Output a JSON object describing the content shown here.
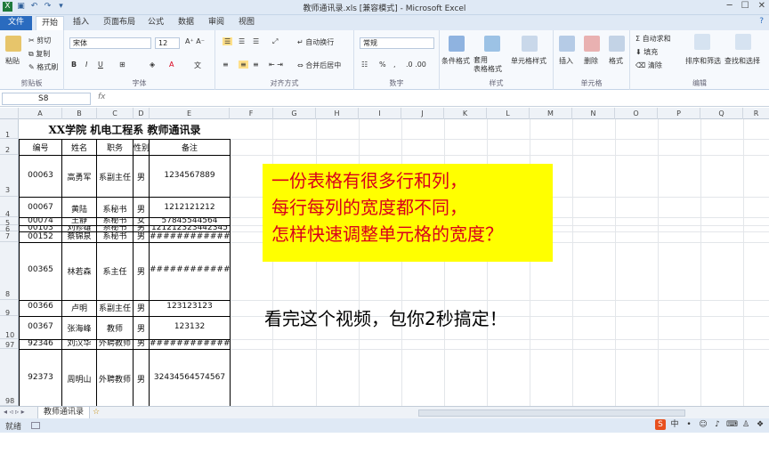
{
  "window": {
    "title": "教师通讯录.xls [兼容模式] - Microsoft Excel"
  },
  "tabs": [
    "文件",
    "开始",
    "插入",
    "页面布局",
    "公式",
    "数据",
    "审阅",
    "视图"
  ],
  "ribbon": {
    "clipboard": {
      "paste": "粘贴",
      "cut": "剪切",
      "copy": "复制",
      "format_painter": "格式刷",
      "label": "剪贴板"
    },
    "font": {
      "name": "宋体",
      "size": "12",
      "label": "字体"
    },
    "alignment": {
      "wrap": "自动换行",
      "merge": "合并后居中",
      "label": "对齐方式"
    },
    "number": {
      "format": "常规",
      "label": "数字"
    },
    "styles": {
      "conditional": "条件格式",
      "table": "套用\n表格格式",
      "cell": "单元格样式",
      "label": "样式"
    },
    "cells": {
      "insert": "插入",
      "delete": "删除",
      "format": "格式",
      "label": "单元格"
    },
    "editing": {
      "autosum": "自动求和",
      "fill": "填充",
      "clear": "清除",
      "sort": "排序和筛选",
      "find": "查找和选择",
      "label": "编辑"
    }
  },
  "formula_bar": {
    "name_box": "S8",
    "fx": "fx"
  },
  "columns": [
    "A",
    "B",
    "C",
    "D",
    "E",
    "F",
    "G",
    "H",
    "I",
    "J",
    "K",
    "L",
    "M",
    "N",
    "O",
    "P",
    "Q",
    "R",
    "S"
  ],
  "rows": [
    "1",
    "2",
    "3",
    "4",
    "5",
    "6",
    "7",
    "8",
    "9",
    "10",
    "97",
    "98"
  ],
  "table": {
    "title": "XX学院  机电工程系  教师通讯录",
    "headers": [
      "编号",
      "姓名",
      "职务",
      "性别",
      "备注"
    ],
    "rows": [
      [
        "00063",
        "高勇军",
        "系副主任",
        "男",
        "1234567889"
      ],
      [
        "00067",
        "黄陆",
        "系秘书",
        "男",
        "1212121212"
      ],
      [
        "00074",
        "王静",
        "系秘书",
        "女",
        "57845544564"
      ],
      [
        "00103",
        "刘修雄",
        "系秘书",
        "男",
        "121212323442345"
      ],
      [
        "00152",
        "蔡锦泉",
        "系秘书",
        "男",
        "################"
      ],
      [
        "00365",
        "林若森",
        "系主任",
        "男",
        "################"
      ],
      [
        "00366",
        "卢明",
        "系副主任",
        "男",
        "123123123"
      ],
      [
        "00367",
        "张海峰",
        "教师",
        "男",
        "123132"
      ],
      [
        "92346",
        "刘汉华",
        "外聘教师",
        "男",
        "################"
      ],
      [
        "92373",
        "周明山",
        "外聘教师",
        "男",
        "32434564574567"
      ]
    ]
  },
  "callout": [
    "一份表格有很多行和列，",
    "每行每列的宽度都不同，",
    "怎样快速调整单元格的宽度？"
  ],
  "subtitle": "看完这个视频，包你2秒搞定！",
  "sheet_tab": "教师通讯录",
  "status": "就绪"
}
